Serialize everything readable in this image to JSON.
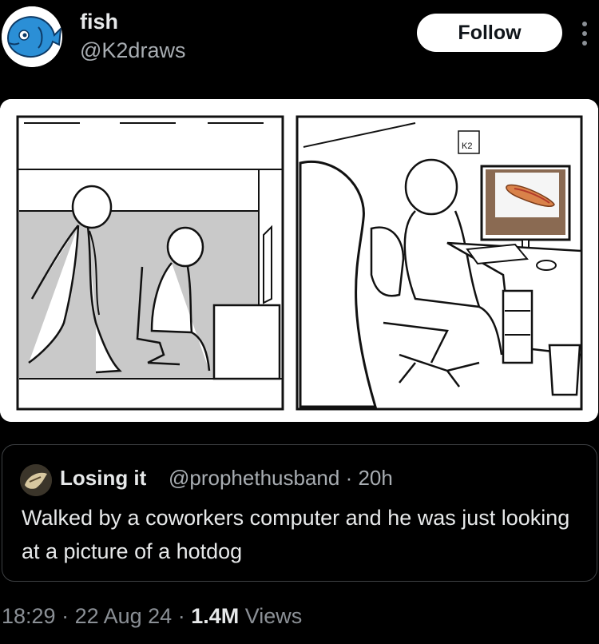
{
  "author": {
    "name": "fish",
    "handle": "@K2draws",
    "avatar_icon": "fish-avatar-icon"
  },
  "follow_label": "Follow",
  "more_icon": "more-vertical-icon",
  "media": {
    "panel_signature": "K2"
  },
  "quote": {
    "name": "Losing it",
    "handle": "@prophethusband",
    "sep": " · ",
    "time": "20h",
    "text": "Walked by a coworkers computer and he was just looking at a picture of a hotdog"
  },
  "footer": {
    "time": "18:29",
    "sep1": " · ",
    "date": "22 Aug 24",
    "sep2": " · ",
    "views_count": "1.4M",
    "views_label": " Views"
  },
  "colors": {
    "background": "#000000",
    "text": "#e7e9ea",
    "muted": "#8b9096",
    "fish_blue": "#2b8fd6"
  }
}
